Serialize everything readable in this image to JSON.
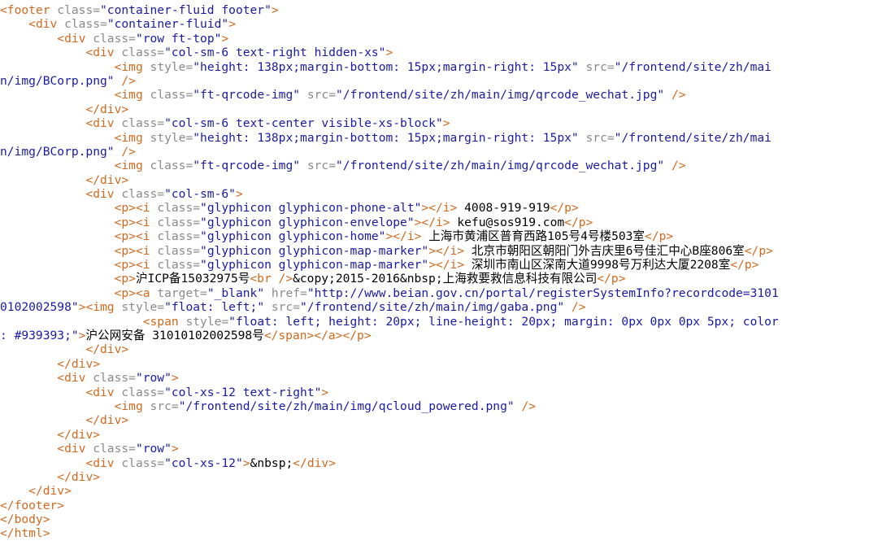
{
  "colors": {
    "tag": "#d2691e",
    "attr": "#8a8a8a",
    "value": "#1a1aa6",
    "text": "#000000",
    "background": "#ffffff"
  },
  "lines": [
    [
      [
        "tag",
        "<footer "
      ],
      [
        "attr",
        "class="
      ],
      [
        "val",
        "\"container-fluid footer\""
      ],
      [
        "tag",
        ">"
      ]
    ],
    [
      [
        "txt",
        "    "
      ],
      [
        "tag",
        "<div "
      ],
      [
        "attr",
        "class="
      ],
      [
        "val",
        "\"container-fluid\""
      ],
      [
        "tag",
        ">"
      ]
    ],
    [
      [
        "txt",
        "        "
      ],
      [
        "tag",
        "<div "
      ],
      [
        "attr",
        "class="
      ],
      [
        "val",
        "\"row ft-top\""
      ],
      [
        "tag",
        ">"
      ]
    ],
    [
      [
        "txt",
        "            "
      ],
      [
        "tag",
        "<div "
      ],
      [
        "attr",
        "class="
      ],
      [
        "val",
        "\"col-sm-6 text-right hidden-xs\""
      ],
      [
        "tag",
        ">"
      ]
    ],
    [
      [
        "txt",
        "                "
      ],
      [
        "tag",
        "<img "
      ],
      [
        "attr",
        "style="
      ],
      [
        "val",
        "\"height: 138px;margin-bottom: 15px;margin-right: 15px\" "
      ],
      [
        "attr",
        "src="
      ],
      [
        "val",
        "\"/frontend/site/zh/mai"
      ]
    ],
    [
      [
        "val",
        "n/img/BCorp.png\" "
      ],
      [
        "tag",
        "/>"
      ]
    ],
    [
      [
        "txt",
        "                "
      ],
      [
        "tag",
        "<img "
      ],
      [
        "attr",
        "class="
      ],
      [
        "val",
        "\"ft-qrcode-img\" "
      ],
      [
        "attr",
        "src="
      ],
      [
        "val",
        "\"/frontend/site/zh/main/img/qrcode_wechat.jpg\" "
      ],
      [
        "tag",
        "/>"
      ]
    ],
    [
      [
        "txt",
        "            "
      ],
      [
        "tag",
        "</div>"
      ]
    ],
    [
      [
        "txt",
        "            "
      ],
      [
        "tag",
        "<div "
      ],
      [
        "attr",
        "class="
      ],
      [
        "val",
        "\"col-sm-6 text-center visible-xs-block\""
      ],
      [
        "tag",
        ">"
      ]
    ],
    [
      [
        "txt",
        "                "
      ],
      [
        "tag",
        "<img "
      ],
      [
        "attr",
        "style="
      ],
      [
        "val",
        "\"height: 138px;margin-bottom: 15px;margin-right: 15px\" "
      ],
      [
        "attr",
        "src="
      ],
      [
        "val",
        "\"/frontend/site/zh/mai"
      ]
    ],
    [
      [
        "val",
        "n/img/BCorp.png\" "
      ],
      [
        "tag",
        "/>"
      ]
    ],
    [
      [
        "txt",
        "                "
      ],
      [
        "tag",
        "<img "
      ],
      [
        "attr",
        "class="
      ],
      [
        "val",
        "\"ft-qrcode-img\" "
      ],
      [
        "attr",
        "src="
      ],
      [
        "val",
        "\"/frontend/site/zh/main/img/qrcode_wechat.jpg\" "
      ],
      [
        "tag",
        "/>"
      ]
    ],
    [
      [
        "txt",
        "            "
      ],
      [
        "tag",
        "</div>"
      ]
    ],
    [
      [
        "txt",
        "            "
      ],
      [
        "tag",
        "<div "
      ],
      [
        "attr",
        "class="
      ],
      [
        "val",
        "\"col-sm-6\""
      ],
      [
        "tag",
        ">"
      ]
    ],
    [
      [
        "txt",
        "                "
      ],
      [
        "tag",
        "<p><i "
      ],
      [
        "attr",
        "class="
      ],
      [
        "val",
        "\"glyphicon glyphicon-phone-alt\""
      ],
      [
        "tag",
        "></i>"
      ],
      [
        "txt",
        " 4008-919-919"
      ],
      [
        "tag",
        "</p>"
      ]
    ],
    [
      [
        "txt",
        "                "
      ],
      [
        "tag",
        "<p><i "
      ],
      [
        "attr",
        "class="
      ],
      [
        "val",
        "\"glyphicon glyphicon-envelope\""
      ],
      [
        "tag",
        "></i>"
      ],
      [
        "txt",
        " kefu@sos919.com"
      ],
      [
        "tag",
        "</p>"
      ]
    ],
    [
      [
        "txt",
        "                "
      ],
      [
        "tag",
        "<p><i "
      ],
      [
        "attr",
        "class="
      ],
      [
        "val",
        "\"glyphicon glyphicon-home\""
      ],
      [
        "tag",
        "></i>"
      ],
      [
        "txt",
        " 上海市黄浦区普育西路105号4号楼503室"
      ],
      [
        "tag",
        "</p>"
      ]
    ],
    [
      [
        "txt",
        "                "
      ],
      [
        "tag",
        "<p><i "
      ],
      [
        "attr",
        "class="
      ],
      [
        "val",
        "\"glyphicon glyphicon-map-marker\""
      ],
      [
        "tag",
        "></i>"
      ],
      [
        "txt",
        " 北京市朝阳区朝阳门外吉庆里6号佳汇中心B座806室"
      ],
      [
        "tag",
        "</p>"
      ]
    ],
    [
      [
        "txt",
        "                "
      ],
      [
        "tag",
        "<p><i "
      ],
      [
        "attr",
        "class="
      ],
      [
        "val",
        "\"glyphicon glyphicon-map-marker\""
      ],
      [
        "tag",
        "></i>"
      ],
      [
        "txt",
        " 深圳市南山区深南大道9998号万利达大厦2208室"
      ],
      [
        "tag",
        "</p>"
      ]
    ],
    [
      [
        "txt",
        "                "
      ],
      [
        "tag",
        "<p>"
      ],
      [
        "txt",
        "沪ICP备15032975号"
      ],
      [
        "tag",
        "<br />"
      ],
      [
        "txt",
        "&copy;2015-2016&nbsp;上海救要救信息科技有限公司"
      ],
      [
        "tag",
        "</p>"
      ]
    ],
    [
      [
        "txt",
        "                "
      ],
      [
        "tag",
        "<p><a "
      ],
      [
        "attr",
        "target="
      ],
      [
        "val",
        "\"_blank\" "
      ],
      [
        "attr",
        "href="
      ],
      [
        "val",
        "\"http://www.beian.gov.cn/portal/registerSystemInfo?recordcode=3101"
      ]
    ],
    [
      [
        "val",
        "0102002598\""
      ],
      [
        "tag",
        "><img "
      ],
      [
        "attr",
        "style="
      ],
      [
        "val",
        "\"float: left;\" "
      ],
      [
        "attr",
        "src="
      ],
      [
        "val",
        "\"/frontend/site/zh/main/img/gaba.png\" "
      ],
      [
        "tag",
        "/>"
      ]
    ],
    [
      [
        "txt",
        "                    "
      ],
      [
        "tag",
        "<span "
      ],
      [
        "attr",
        "style="
      ],
      [
        "val",
        "\"float: left; height: 20px; line-height: 20px; margin: 0px 0px 0px 5px; color"
      ]
    ],
    [
      [
        "val",
        ": #939393;\""
      ],
      [
        "tag",
        ">"
      ],
      [
        "txt",
        "沪公网安备 31010102002598号"
      ],
      [
        "tag",
        "</span></a></p>"
      ]
    ],
    [
      [
        "txt",
        "            "
      ],
      [
        "tag",
        "</div>"
      ]
    ],
    [
      [
        "txt",
        "        "
      ],
      [
        "tag",
        "</div>"
      ]
    ],
    [
      [
        "txt",
        "        "
      ],
      [
        "tag",
        "<div "
      ],
      [
        "attr",
        "class="
      ],
      [
        "val",
        "\"row\""
      ],
      [
        "tag",
        ">"
      ]
    ],
    [
      [
        "txt",
        "            "
      ],
      [
        "tag",
        "<div "
      ],
      [
        "attr",
        "class="
      ],
      [
        "val",
        "\"col-xs-12 text-right\""
      ],
      [
        "tag",
        ">"
      ]
    ],
    [
      [
        "txt",
        "                "
      ],
      [
        "tag",
        "<img "
      ],
      [
        "attr",
        "src="
      ],
      [
        "val",
        "\"/frontend/site/zh/main/img/qcloud_powered.png\" "
      ],
      [
        "tag",
        "/>"
      ]
    ],
    [
      [
        "txt",
        "            "
      ],
      [
        "tag",
        "</div>"
      ]
    ],
    [
      [
        "txt",
        "        "
      ],
      [
        "tag",
        "</div>"
      ]
    ],
    [
      [
        "txt",
        "        "
      ],
      [
        "tag",
        "<div "
      ],
      [
        "attr",
        "class="
      ],
      [
        "val",
        "\"row\""
      ],
      [
        "tag",
        ">"
      ]
    ],
    [
      [
        "txt",
        "            "
      ],
      [
        "tag",
        "<div "
      ],
      [
        "attr",
        "class="
      ],
      [
        "val",
        "\"col-xs-12\""
      ],
      [
        "tag",
        ">"
      ],
      [
        "txt",
        "&nbsp;"
      ],
      [
        "tag",
        "</div>"
      ]
    ],
    [
      [
        "txt",
        "        "
      ],
      [
        "tag",
        "</div>"
      ]
    ],
    [
      [
        "txt",
        "    "
      ],
      [
        "tag",
        "</div>"
      ]
    ],
    [
      [
        "tag",
        "</footer>"
      ]
    ],
    [
      [
        "tag",
        "</body>"
      ]
    ],
    [
      [
        "tag",
        "</html>"
      ]
    ]
  ]
}
